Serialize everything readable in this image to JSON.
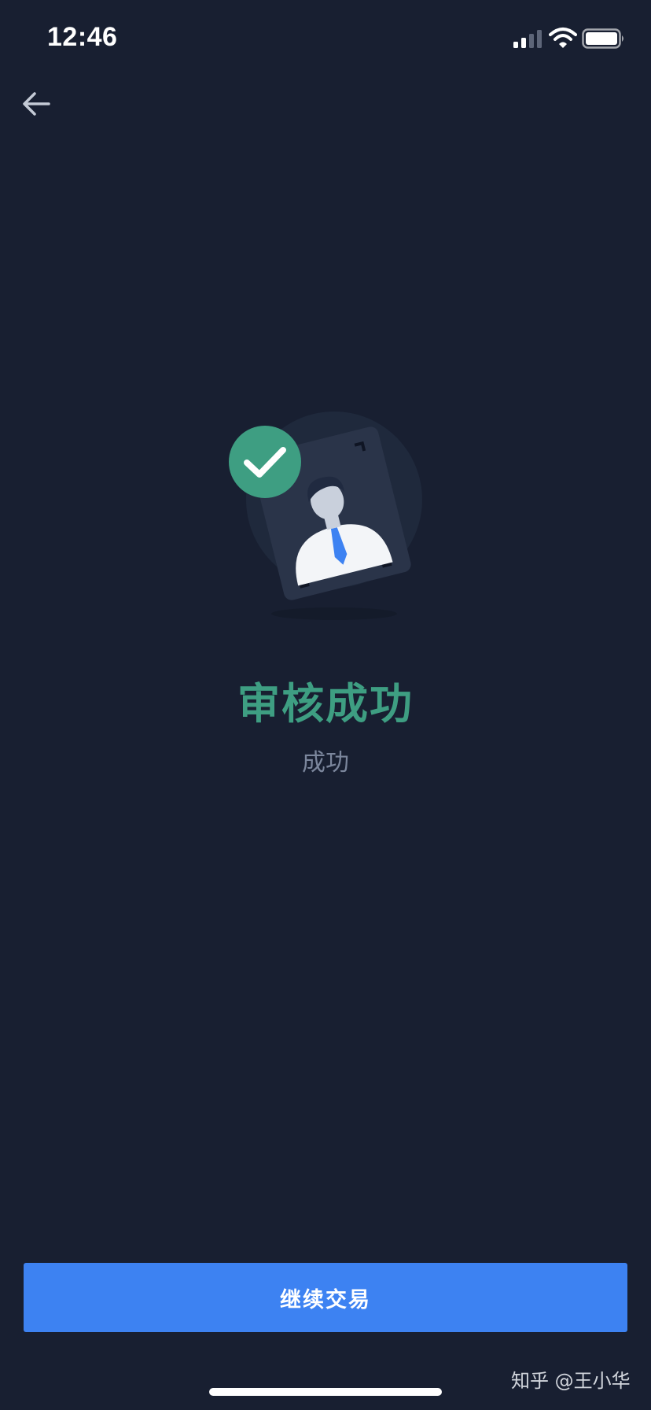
{
  "status_bar": {
    "time": "12:46",
    "icons": [
      "signal-icon",
      "wifi-icon",
      "battery-icon"
    ]
  },
  "nav": {
    "back_icon": "arrow-left-icon"
  },
  "illustration": {
    "icons": [
      "check-circle-icon",
      "id-card-person-icon"
    ]
  },
  "result": {
    "title": "审核成功",
    "subtitle": "成功"
  },
  "actions": {
    "continue_label": "继续交易"
  },
  "watermark": {
    "text": "知乎 @王小华"
  },
  "colors": {
    "background": "#181f31",
    "accent_green": "#3e9e82",
    "button_blue": "#3d82f2",
    "subtitle_gray": "#7b869c"
  }
}
